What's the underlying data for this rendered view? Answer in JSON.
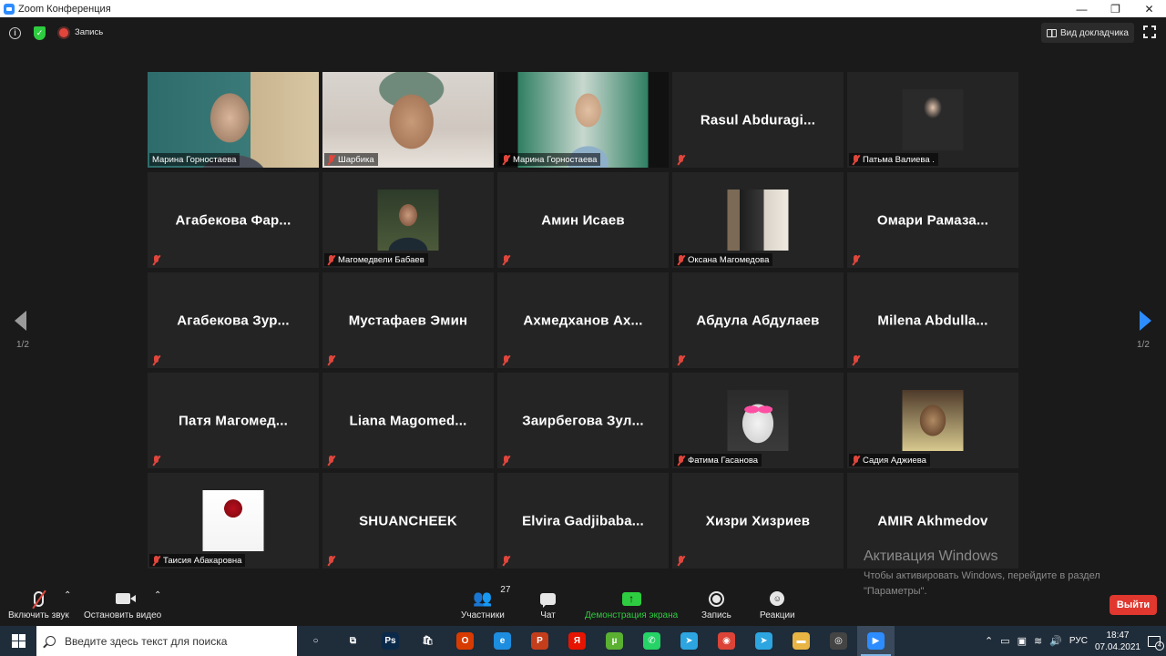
{
  "window": {
    "title": "Zoom Конференция",
    "controls": [
      "—",
      "❐",
      "✕"
    ]
  },
  "topbar": {
    "record_label": "Запись",
    "speaker_view_label": "Вид докладчика"
  },
  "pager": {
    "left_label": "1/2",
    "right_label": "1/2"
  },
  "tiles": [
    {
      "name": "Марина Горностаева",
      "caption": "Марина Горностаева",
      "video": true,
      "muted": false,
      "active": true
    },
    {
      "name": "Шарбика",
      "caption": "Шарбика",
      "video": true,
      "muted": true
    },
    {
      "name": "Марина Горностаева",
      "caption": "Марина Горностаева",
      "video": true,
      "muted": true
    },
    {
      "name": "Rasul  Abduragi...",
      "caption": "",
      "muted": true
    },
    {
      "name": "Патьма Валиева .",
      "caption": "Патьма Валиева .",
      "photo": true,
      "muted": true
    },
    {
      "name": "Агабекова  Фар...",
      "caption": "",
      "muted": true
    },
    {
      "name": "Магомедвели Бабаев",
      "caption": "Магомедвели Бабаев",
      "photo": true,
      "muted": true
    },
    {
      "name": "Амин Исаев",
      "caption": "",
      "muted": true
    },
    {
      "name": "Оксана Магомедова",
      "caption": "Оксана Магомедова",
      "photo": true,
      "muted": true
    },
    {
      "name": "Омари  Рамаза...",
      "caption": "",
      "muted": true
    },
    {
      "name": "Агабекова  Зур...",
      "caption": "",
      "muted": true
    },
    {
      "name": "Мустафаев Эмин",
      "caption": "",
      "muted": true
    },
    {
      "name": "Ахмедханов  Ах...",
      "caption": "",
      "muted": true
    },
    {
      "name": "Абдула Абдулаев",
      "caption": "",
      "muted": true
    },
    {
      "name": "Milena  Abdulla...",
      "caption": "",
      "muted": true
    },
    {
      "name": "Патя  Магомед...",
      "caption": "",
      "muted": true
    },
    {
      "name": "Liana  Magomed...",
      "caption": "",
      "muted": true
    },
    {
      "name": "Заирбегова  Зул...",
      "caption": "",
      "muted": true
    },
    {
      "name": "Фатима Гасанова",
      "caption": "Фатима Гасанова",
      "photo": true,
      "muted": true
    },
    {
      "name": "Садия Аджиева",
      "caption": "Садия Аджиева",
      "photo": true,
      "muted": true
    },
    {
      "name": "Таисия Абакаровна",
      "caption": "Таисия Абакаровна",
      "photo": true,
      "muted": true
    },
    {
      "name": "SHUANCHEEK",
      "caption": "",
      "muted": true
    },
    {
      "name": "Elvira  Gadjibaba...",
      "caption": "",
      "muted": true
    },
    {
      "name": "Хизри Хизриев",
      "caption": "",
      "muted": true
    },
    {
      "name": "AMIR Akhmedov",
      "caption": "",
      "muted": false
    }
  ],
  "activation": {
    "title": "Активация Windows",
    "text": "Чтобы активировать Windows, перейдите в раздел \"Параметры\"."
  },
  "toolbar": {
    "unmute_label": "Включить звук",
    "stop_video_label": "Остановить видео",
    "participants_label": "Участники",
    "participants_count": "27",
    "chat_label": "Чат",
    "share_label": "Демонстрация экрана",
    "record_label": "Запись",
    "reactions_label": "Реакции",
    "leave_label": "Выйти",
    "caret": "⌃"
  },
  "taskbar": {
    "search_placeholder": "Введите здесь текст для поиска",
    "apps": [
      {
        "name": "cortana-icon",
        "glyph": "○",
        "color": "transparent"
      },
      {
        "name": "task-view-icon",
        "glyph": "⧉",
        "color": "transparent"
      },
      {
        "name": "photoshop-icon",
        "glyph": "Ps",
        "color": "#0b2a4a"
      },
      {
        "name": "store-icon",
        "glyph": "🛍",
        "color": "transparent"
      },
      {
        "name": "office-icon",
        "glyph": "O",
        "color": "#d83b01"
      },
      {
        "name": "edge-icon",
        "glyph": "e",
        "color": "#1d8ddf"
      },
      {
        "name": "powerpoint-icon",
        "glyph": "P",
        "color": "#c43e1c"
      },
      {
        "name": "yandex-icon",
        "glyph": "Я",
        "color": "#e61400"
      },
      {
        "name": "utorrent-icon",
        "glyph": "µ",
        "color": "#5ab031"
      },
      {
        "name": "whatsapp-icon",
        "glyph": "✆",
        "color": "#25d366"
      },
      {
        "name": "telegram-icon",
        "glyph": "➤",
        "color": "#2ca5e0"
      },
      {
        "name": "chrome-icon",
        "glyph": "◉",
        "color": "#db4437"
      },
      {
        "name": "telegram-2-icon",
        "glyph": "➤",
        "color": "#2ca5e0"
      },
      {
        "name": "explorer-icon",
        "glyph": "▬",
        "color": "#e8b443"
      },
      {
        "name": "media-icon",
        "glyph": "◎",
        "color": "#444"
      },
      {
        "name": "zoom-icon",
        "glyph": "▶",
        "color": "#2d8cff",
        "active": true
      }
    ],
    "tray": {
      "chevron": "⌃",
      "lang": "РУС",
      "time": "18:47",
      "date": "07.04.2021",
      "notifications": "4"
    }
  }
}
